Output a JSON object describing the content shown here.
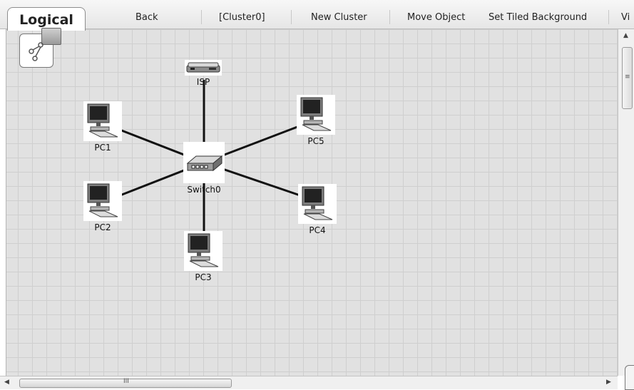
{
  "toolbar": {
    "active_tab": "Logical",
    "buttons": [
      {
        "label": "Back"
      },
      {
        "label": "[Cluster0]"
      },
      {
        "label": "New Cluster"
      },
      {
        "label": "Move Object"
      },
      {
        "label": "Set Tiled Background"
      },
      {
        "label": "Vi"
      }
    ]
  },
  "devices": {
    "isp": {
      "label": "ISP",
      "kind": "router"
    },
    "switch0": {
      "label": "Switch0",
      "kind": "switch"
    },
    "pc1": {
      "label": "PC1",
      "kind": "pc"
    },
    "pc2": {
      "label": "PC2",
      "kind": "pc"
    },
    "pc3": {
      "label": "PC3",
      "kind": "pc"
    },
    "pc4": {
      "label": "PC4",
      "kind": "pc"
    },
    "pc5": {
      "label": "PC5",
      "kind": "pc"
    }
  },
  "scrollbars": {
    "vertical_grip": "≡",
    "horizontal_grip": "III"
  },
  "colors": {
    "workspace": "#e1e1e1",
    "grid": "#cfcfcf",
    "link": "#111111"
  }
}
